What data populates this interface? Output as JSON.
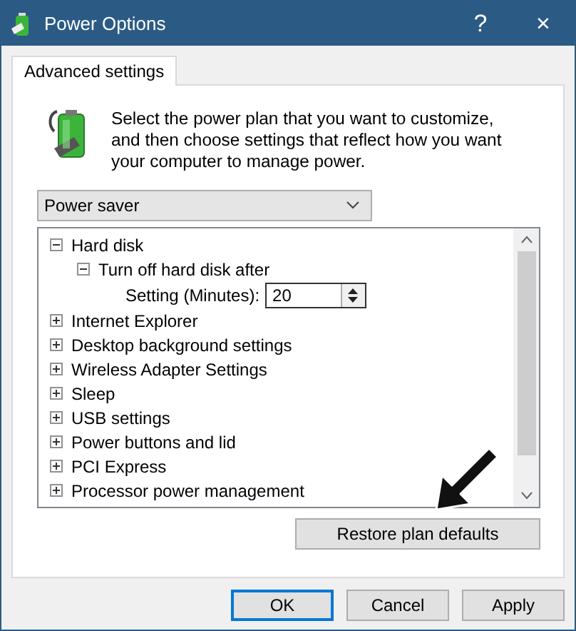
{
  "window": {
    "title": "Power Options",
    "help": "?",
    "close": "×"
  },
  "tabs": [
    {
      "label": "Advanced settings",
      "selected": true
    }
  ],
  "description": "Select the power plan that you want to customize, and then choose settings that reflect how you want your computer to manage power.",
  "plan_select": {
    "value": "Power saver"
  },
  "settings_tree": [
    {
      "kind": "group",
      "label": "Hard disk",
      "expanded": true,
      "children": [
        {
          "kind": "group",
          "label": "Turn off hard disk after",
          "expanded": true,
          "children": [
            {
              "kind": "spinner",
              "label": "Setting (Minutes):",
              "value": "20"
            }
          ]
        }
      ]
    },
    {
      "kind": "group",
      "label": "Internet Explorer",
      "expanded": false
    },
    {
      "kind": "group",
      "label": "Desktop background settings",
      "expanded": false
    },
    {
      "kind": "group",
      "label": "Wireless Adapter Settings",
      "expanded": false
    },
    {
      "kind": "group",
      "label": "Sleep",
      "expanded": false
    },
    {
      "kind": "group",
      "label": "USB settings",
      "expanded": false
    },
    {
      "kind": "group",
      "label": "Power buttons and lid",
      "expanded": false
    },
    {
      "kind": "group",
      "label": "PCI Express",
      "expanded": false
    },
    {
      "kind": "group",
      "label": "Processor power management",
      "expanded": false
    }
  ],
  "restore_button": "Restore plan defaults",
  "buttons": [
    {
      "label": "OK",
      "default": true
    },
    {
      "label": "Cancel",
      "default": false
    },
    {
      "label": "Apply",
      "default": false
    }
  ]
}
